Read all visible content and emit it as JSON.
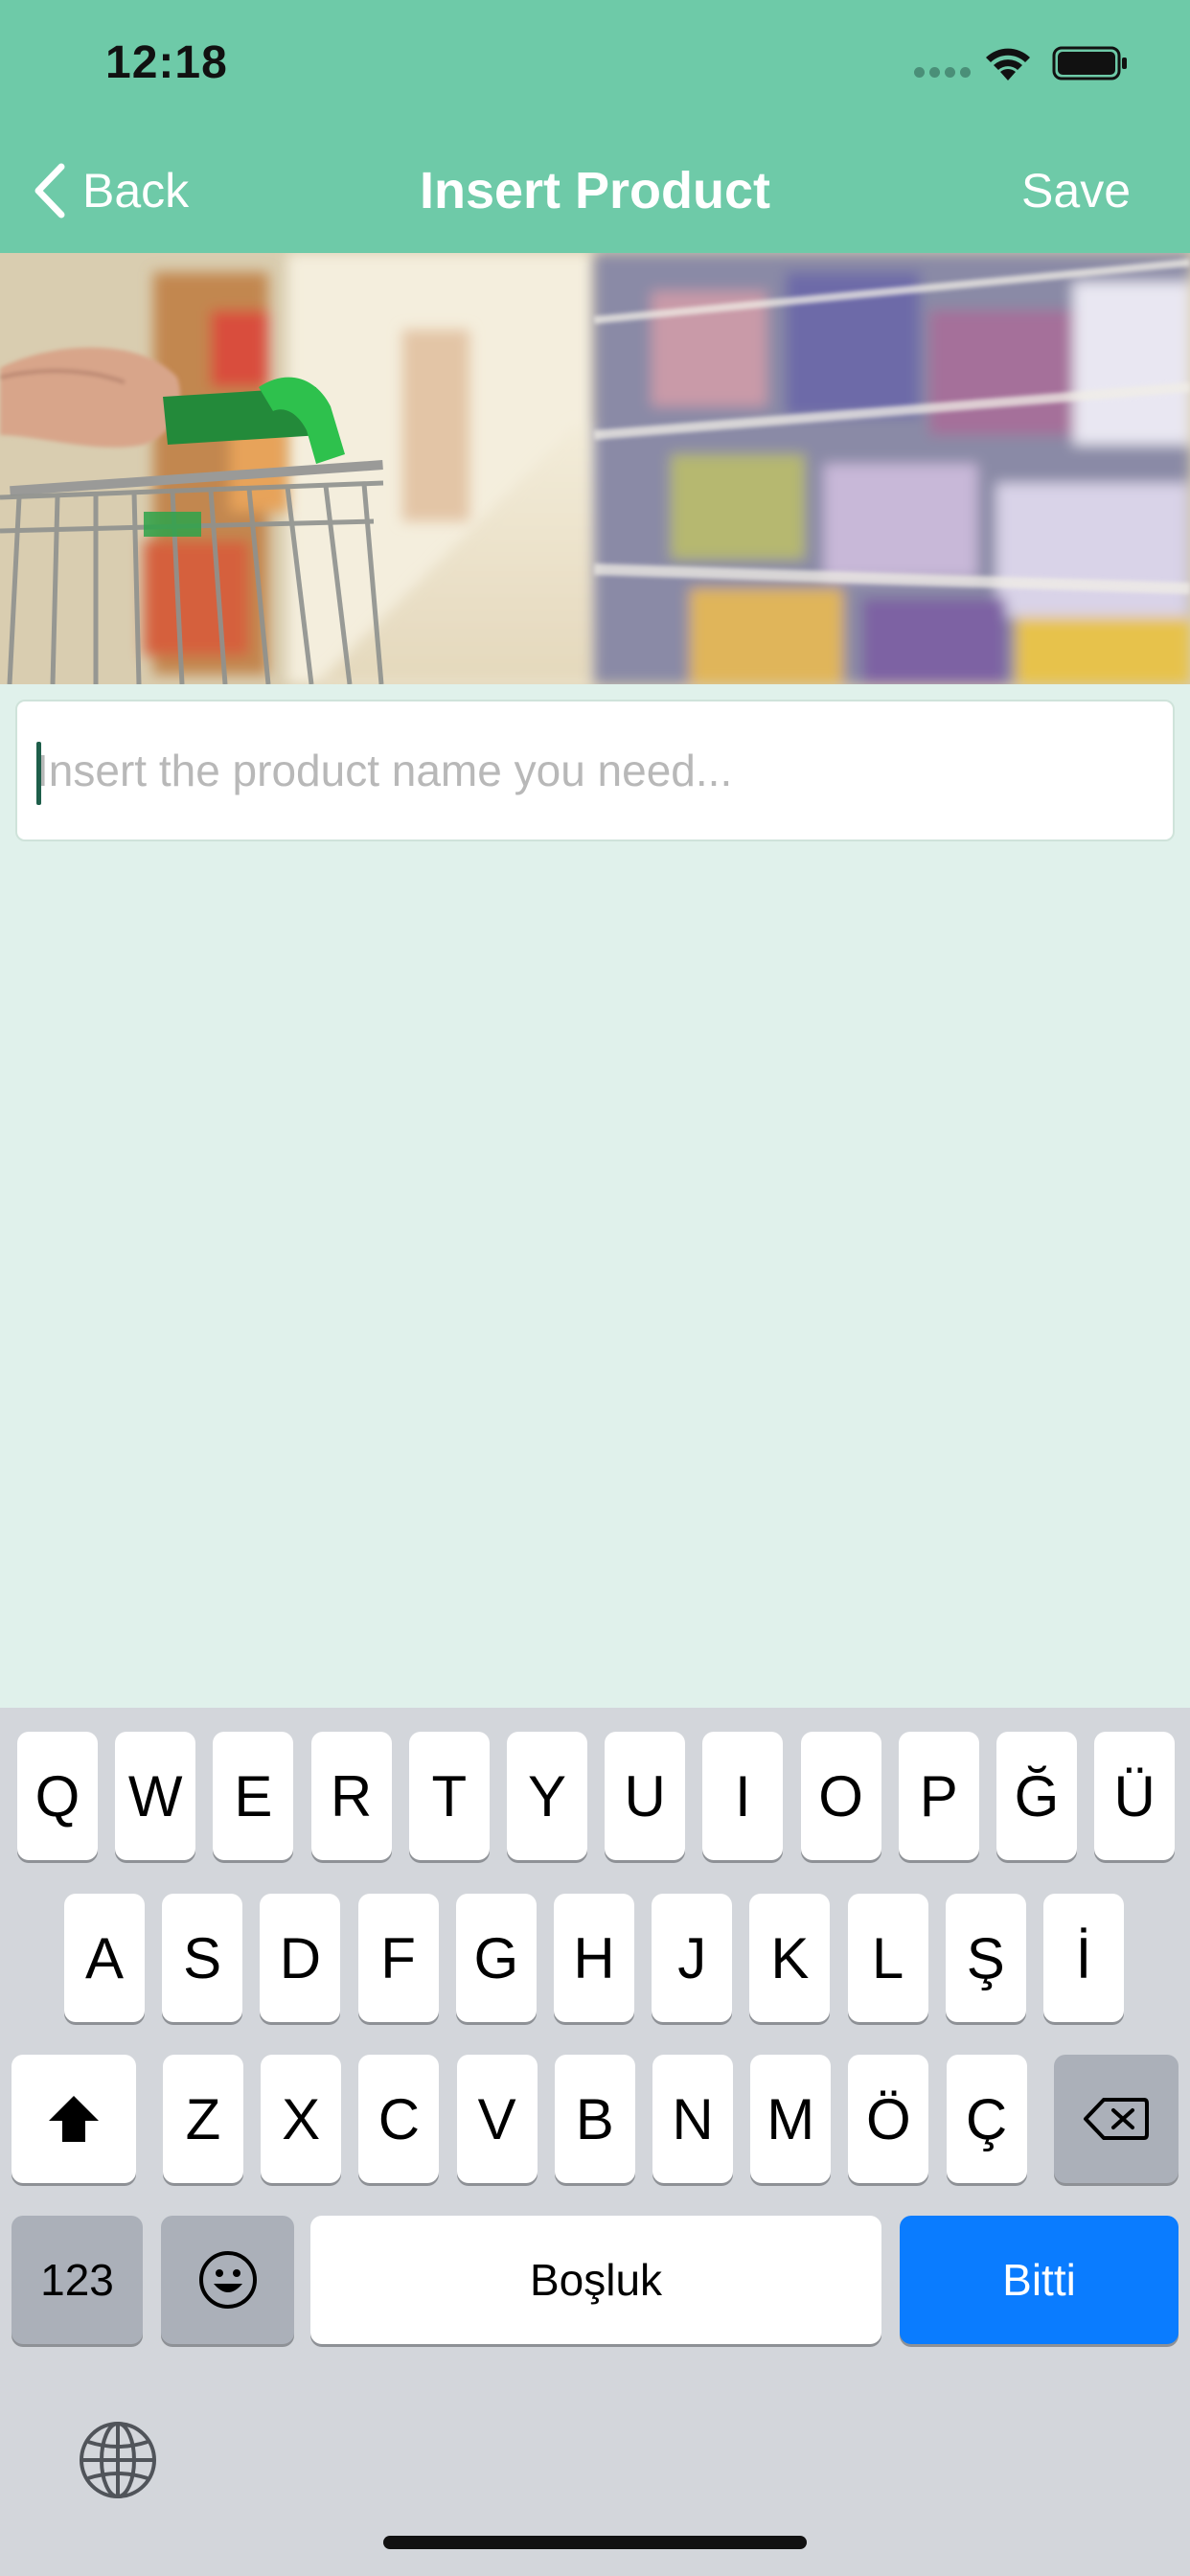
{
  "status_bar": {
    "time": "12:18"
  },
  "nav": {
    "back_label": "Back",
    "title": "Insert Product",
    "save_label": "Save"
  },
  "product_input": {
    "placeholder": "Insert the product name you need...",
    "value": ""
  },
  "keyboard": {
    "row1": [
      "Q",
      "W",
      "E",
      "R",
      "T",
      "Y",
      "U",
      "I",
      "O",
      "P",
      "Ğ",
      "Ü"
    ],
    "row2": [
      "A",
      "S",
      "D",
      "F",
      "G",
      "H",
      "J",
      "K",
      "L",
      "Ş",
      "İ"
    ],
    "row3": [
      "Z",
      "X",
      "C",
      "V",
      "B",
      "N",
      "M",
      "Ö",
      "Ç"
    ],
    "numbers_label": "123",
    "space_label": "Boşluk",
    "done_label": "Bitti"
  },
  "colors": {
    "nav_background": "#6ecaa8",
    "page_background": "#e0f1eb",
    "done_key": "#0a7cff",
    "caret": "#1e5e4a"
  },
  "icons": {
    "back": "chevron-left-icon",
    "shift": "shift-arrow-icon",
    "delete": "backspace-icon",
    "emoji": "smiley-icon",
    "globe": "globe-icon"
  }
}
